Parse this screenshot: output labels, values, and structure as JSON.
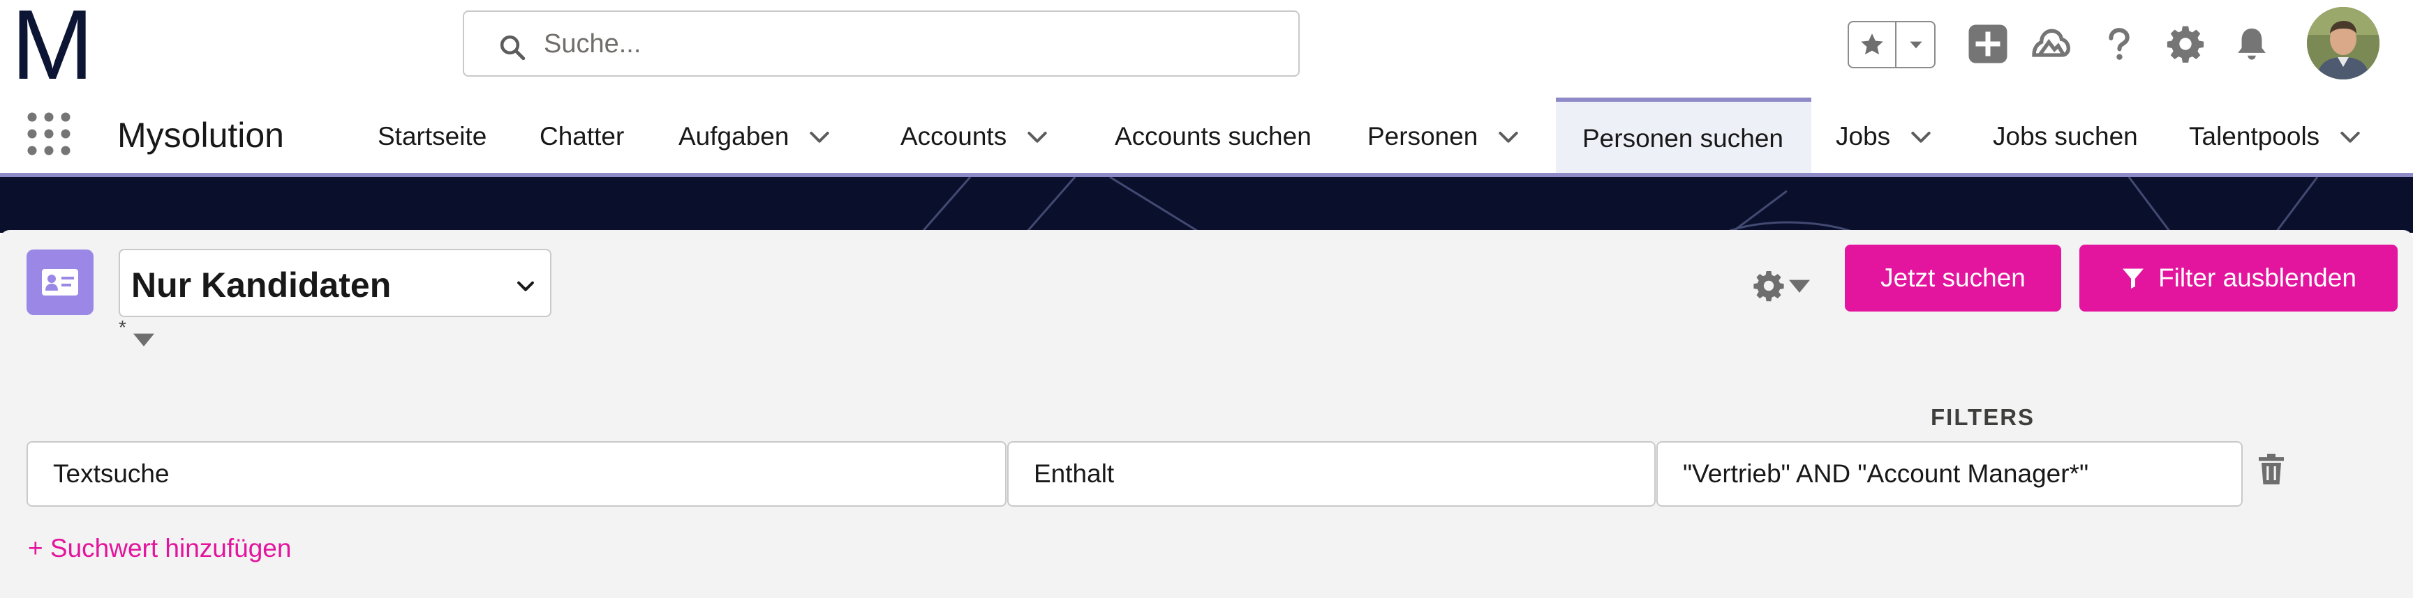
{
  "header": {
    "logo": "M",
    "search_placeholder": "Suche..."
  },
  "nav": {
    "app_name": "Mysolution",
    "items": [
      {
        "label": "Startseite",
        "dropdown": false
      },
      {
        "label": "Chatter",
        "dropdown": false
      },
      {
        "label": "Aufgaben",
        "dropdown": true
      },
      {
        "label": "Accounts",
        "dropdown": true
      },
      {
        "label": "Accounts suchen",
        "dropdown": false
      },
      {
        "label": "Personen",
        "dropdown": true
      },
      {
        "label": "Personen suchen",
        "dropdown": false,
        "active": true
      },
      {
        "label": "Jobs",
        "dropdown": true
      },
      {
        "label": "Jobs suchen",
        "dropdown": false
      },
      {
        "label": "Talentpools",
        "dropdown": true
      }
    ]
  },
  "panel": {
    "list_view": "Nur Kandidaten",
    "asterisk": "*",
    "search_button": "Jetzt suchen",
    "filter_button": "Filter ausblenden",
    "filters_heading": "FILTERS",
    "filter_row": {
      "field": "Textsuche",
      "operator": "Enthalt",
      "value": "\"Vertrieb\" AND \"Account Manager*\""
    },
    "add_value_link": "+ Suchwert hinzufügen"
  },
  "colors": {
    "accent": "#e3149d",
    "nav_active": "#8e8ac8",
    "entity_icon": "#9b87e6",
    "logo": "#0d1535",
    "banner": "#0a0f2c"
  },
  "icons": [
    "search-icon",
    "star-icon",
    "chevron-down-icon",
    "add-icon",
    "trailhead-icon",
    "help-icon",
    "gear-icon",
    "bell-icon",
    "app-launcher-icon",
    "contact-card-icon",
    "filter-icon",
    "trash-icon"
  ]
}
